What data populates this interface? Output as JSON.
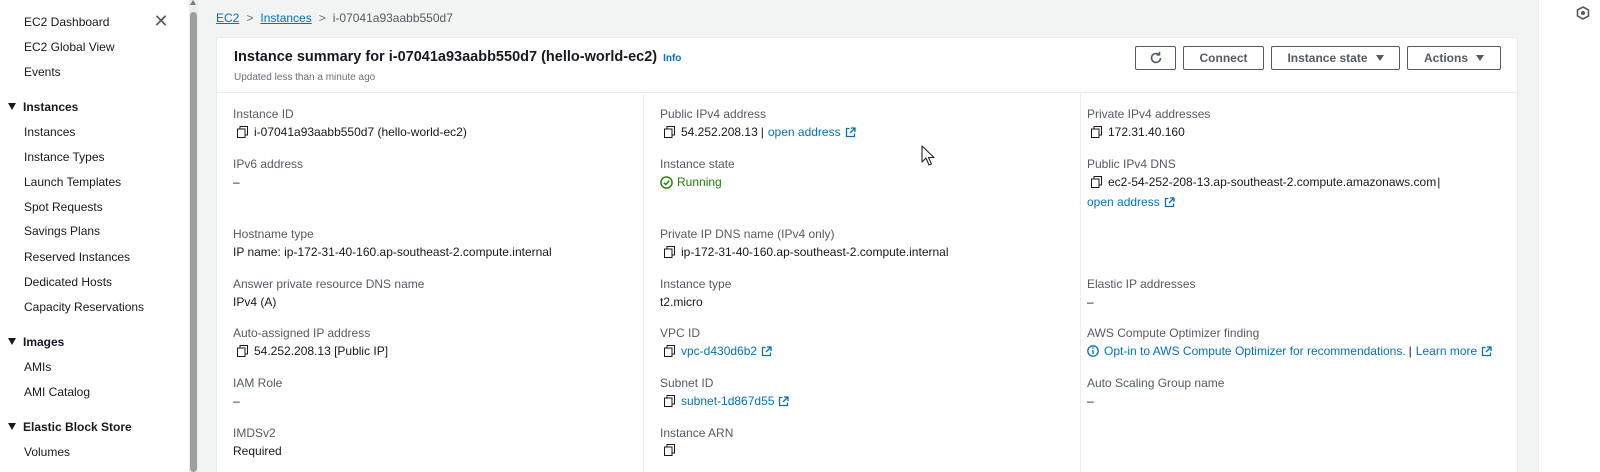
{
  "sidebar": {
    "top_items": [
      "EC2 Dashboard",
      "EC2 Global View",
      "Events"
    ],
    "sections": [
      {
        "title": "Instances",
        "items": [
          "Instances",
          "Instance Types",
          "Launch Templates",
          "Spot Requests",
          "Savings Plans",
          "Reserved Instances",
          "Dedicated Hosts",
          "Capacity Reservations"
        ]
      },
      {
        "title": "Images",
        "items": [
          "AMIs",
          "AMI Catalog"
        ]
      },
      {
        "title": "Elastic Block Store",
        "items": [
          "Volumes"
        ]
      }
    ]
  },
  "breadcrumb": [
    "EC2",
    "Instances",
    "i-07041a93aabb550d7"
  ],
  "summary": {
    "title": "Instance summary for i-07041a93aabb550d7 (hello-world-ec2)",
    "info": "Info",
    "updated": "Updated less than a minute ago",
    "connect_label": "Connect",
    "instance_state_label": "Instance state",
    "actions_label": "Actions"
  },
  "fields": {
    "instance_id": {
      "label": "Instance ID",
      "value": "i-07041a93aabb550d7 (hello-world-ec2)"
    },
    "public_ipv4": {
      "label": "Public IPv4 address",
      "value": "54.252.208.13",
      "link": "open address"
    },
    "private_ipv4": {
      "label": "Private IPv4 addresses",
      "value": "172.31.40.160"
    },
    "ipv6": {
      "label": "IPv6 address",
      "value": "–"
    },
    "instance_state": {
      "label": "Instance state",
      "value": "Running"
    },
    "public_dns": {
      "label": "Public IPv4 DNS",
      "value": "ec2-54-252-208-13.ap-southeast-2.compute.amazonaws.com",
      "link": "open address"
    },
    "hostname_type": {
      "label": "Hostname type",
      "value": "IP name: ip-172-31-40-160.ap-southeast-2.compute.internal"
    },
    "private_dns": {
      "label": "Private IP DNS name (IPv4 only)",
      "value": "ip-172-31-40-160.ap-southeast-2.compute.internal"
    },
    "answer_dns": {
      "label": "Answer private resource DNS name",
      "value": "IPv4 (A)"
    },
    "instance_type": {
      "label": "Instance type",
      "value": "t2.micro"
    },
    "elastic_ip": {
      "label": "Elastic IP addresses",
      "value": "–"
    },
    "auto_ip": {
      "label": "Auto-assigned IP address",
      "value": "54.252.208.13 [Public IP]"
    },
    "vpc_id": {
      "label": "VPC ID",
      "value": "vpc-d430d6b2"
    },
    "optimizer": {
      "label": "AWS Compute Optimizer finding",
      "value": "Opt-in to AWS Compute Optimizer for recommendations.",
      "link": "Learn more"
    },
    "iam_role": {
      "label": "IAM Role",
      "value": "–"
    },
    "subnet_id": {
      "label": "Subnet ID",
      "value": "subnet-1d867d55"
    },
    "asg_name": {
      "label": "Auto Scaling Group name",
      "value": "–"
    },
    "imdsv2": {
      "label": "IMDSv2",
      "value": "Required"
    },
    "instance_arn": {
      "label": "Instance ARN"
    }
  },
  "colors": {
    "link": "#0073bb",
    "running": "#1d8102",
    "text": "#16191f",
    "label": "#545b64"
  }
}
